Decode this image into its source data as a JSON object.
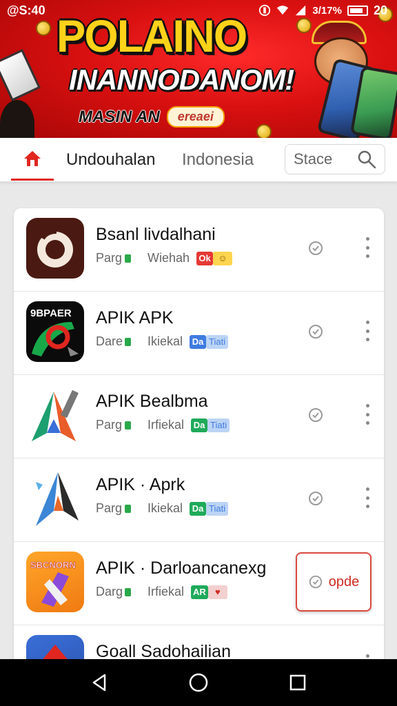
{
  "status_bar": {
    "time": "@S:40",
    "signal_text": "3/17%",
    "battery": "20"
  },
  "banner": {
    "title": "POLAINO",
    "subtitle": "INANNODANOM!",
    "small_text": "MASIN AN",
    "pill_text": "ereaei"
  },
  "tabs": {
    "home_icon": "home-icon",
    "tab1": "Undouhalan",
    "tab2": "Indonesia",
    "search_label": "Stace",
    "search_icon": "search-icon"
  },
  "apps": [
    {
      "name": "Bsanl livdalhani",
      "meta_a": "Parg",
      "meta_b": "Wiehah",
      "badge1": "Ok",
      "badge1_color": "#e53935",
      "badge2": "☺",
      "badge2_color": "#ffd54f"
    },
    {
      "name": "APIK APK",
      "meta_a": "Dare",
      "meta_b": "Ikiekal",
      "badge1": "Da",
      "badge1_color": "#3f7be0",
      "badge2": "Tiati",
      "badge2_color": "#bcd4f5"
    },
    {
      "name": "APIK Bealbma",
      "meta_a": "Parg",
      "meta_b": "Irfiekal",
      "badge1": "Da",
      "badge1_color": "#1faa5a",
      "badge2": "Tiati",
      "badge2_color": "#bcd4f5"
    },
    {
      "name": "APIK · Aprk",
      "meta_a": "Parg",
      "meta_b": "Ikiekal",
      "badge1": "Da",
      "badge1_color": "#1faa5a",
      "badge2": "Tiati",
      "badge2_color": "#bcd4f5"
    },
    {
      "name": "APIK · Darloancanexg",
      "meta_a": "Darg",
      "meta_b": "Irfiekal",
      "badge1": "AR",
      "badge1_color": "#1faa5a",
      "badge2": "♥",
      "badge2_color": "#f3d0d0"
    },
    {
      "name": "Goall Sadohailian",
      "meta_a": "",
      "meta_b": "",
      "badge1": "",
      "badge1_color": "#ffffff",
      "badge2": "",
      "badge2_color": "#ffffff"
    }
  ],
  "open_button": {
    "label": "opde"
  },
  "colors": {
    "accent": "#e0261f",
    "banner_red": "#d91010",
    "title_yellow": "#ffd21a"
  },
  "nav": {
    "back": "back-icon",
    "home": "home-circle-icon",
    "recents": "recents-icon"
  }
}
